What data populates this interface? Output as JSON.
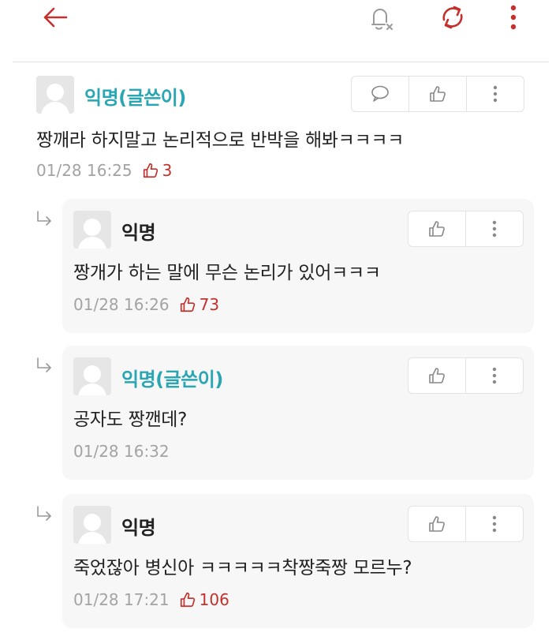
{
  "colors": {
    "accent": "#c4302b",
    "author": "#2aa6b3"
  },
  "topbar": {
    "icons": [
      "back-arrow-icon",
      "bell-off-icon",
      "refresh-icon",
      "more-vertical-icon"
    ]
  },
  "comments": [
    {
      "name": "익명(글쓴이)",
      "is_author": true,
      "text": "짱깨라 하지말고 논리적으로 반박을 해봐ㅋㅋㅋㅋ",
      "timestamp": "01/28 16:25",
      "likes": "3"
    },
    {
      "name": "익명",
      "is_author": false,
      "text": "짱개가 하는 말에 무슨 논리가 있어ㅋㅋㅋ",
      "timestamp": "01/28 16:26",
      "likes": "73"
    },
    {
      "name": "익명(글쓴이)",
      "is_author": true,
      "text": "공자도 짱깬데?",
      "timestamp": "01/28 16:32",
      "likes": ""
    },
    {
      "name": "익명",
      "is_author": false,
      "text": "죽었잖아 병신아 ㅋㅋㅋㅋㅋ착짱죽짱 모르누?",
      "timestamp": "01/28 17:21",
      "likes": "106"
    }
  ]
}
